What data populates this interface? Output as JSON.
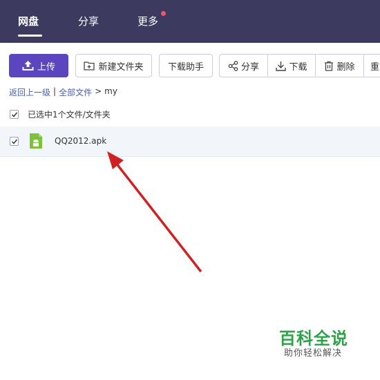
{
  "nav": {
    "items": [
      {
        "label": "网盘",
        "active": true
      },
      {
        "label": "分享",
        "active": false
      },
      {
        "label": "更多",
        "active": false,
        "has_notification": true
      }
    ]
  },
  "toolbar": {
    "upload_label": "上传",
    "new_folder_label": "新建文件夹",
    "download_helper_label": "下载助手",
    "share_label": "分享",
    "download_label": "下载",
    "delete_label": "删除",
    "more_partial_label": "重"
  },
  "breadcrumb": {
    "back_label": "返回上一级",
    "separator": "|",
    "all_files_label": "全部文件",
    "arrow": ">",
    "current": "my"
  },
  "selection": {
    "status_text": "已选中1个文件/文件夹",
    "checked": true
  },
  "files": [
    {
      "name": "QQ2012.apk",
      "icon": "android-icon",
      "checked": true
    }
  ],
  "watermark": {
    "title": "百科全说",
    "subtitle": "助你轻松解决"
  },
  "colors": {
    "nav_bg": "#3c3a5e",
    "primary": "#5b46bf",
    "android_green": "#7cc23b",
    "arrow_red": "#d22020",
    "watermark_green": "#2fa14a"
  }
}
